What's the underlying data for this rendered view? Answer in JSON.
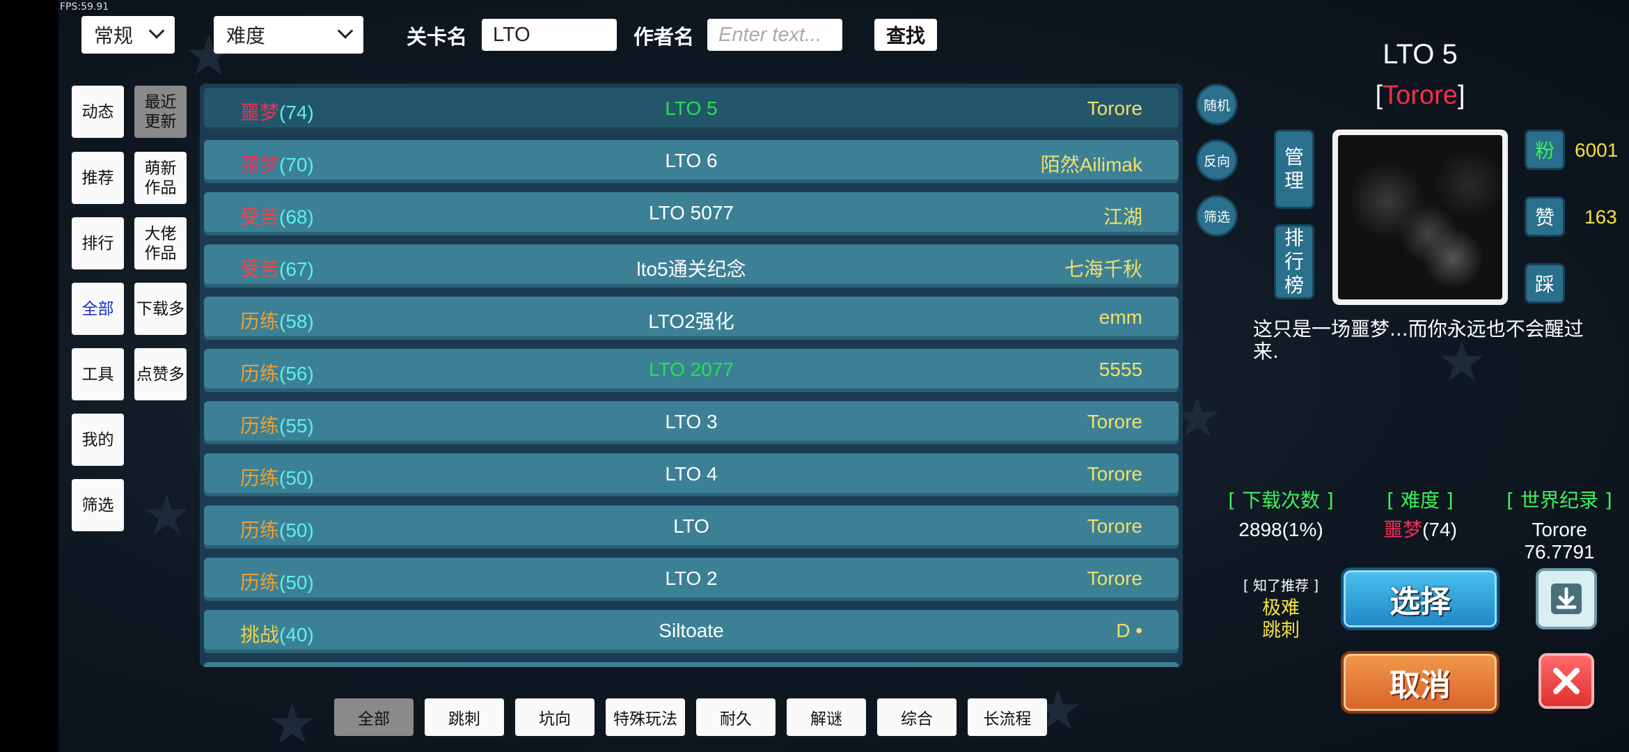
{
  "fps": "FPS:59.91",
  "top_bar": {
    "mode_dropdown": "常规",
    "difficulty_dropdown": "难度",
    "level_name_label": "关卡名",
    "level_name_value": "LTO",
    "author_label": "作者名",
    "author_placeholder": "Enter text...",
    "search_button": "查找"
  },
  "left_categories": {
    "col1": [
      "动态",
      "推荐",
      "排行",
      "全部",
      "工具",
      "我的",
      "筛选"
    ],
    "col2": [
      "最近\n更新",
      "萌新\n作品",
      "大佬\n作品",
      "下载多",
      "点赞多"
    ]
  },
  "levels": [
    {
      "diff": "噩梦",
      "num": "(74)",
      "name": "LTO 5",
      "author": "Torore"
    },
    {
      "diff": "噩梦",
      "num": "(70)",
      "name": "LTO 6",
      "author": "陌然Ailimak"
    },
    {
      "diff": "受苦",
      "num": "(68)",
      "name": "LTO 5077",
      "author": "江湖"
    },
    {
      "diff": "受苦",
      "num": "(67)",
      "name": "lto5通关纪念",
      "author": "七海千秋"
    },
    {
      "diff": "历练",
      "num": "(58)",
      "name": "LTO2强化",
      "author": "emm"
    },
    {
      "diff": "历练",
      "num": "(56)",
      "name": "LTO 2077",
      "author": "5555"
    },
    {
      "diff": "历练",
      "num": "(55)",
      "name": "LTO 3",
      "author": "Torore"
    },
    {
      "diff": "历练",
      "num": "(50)",
      "name": "LTO 4",
      "author": "Torore"
    },
    {
      "diff": "历练",
      "num": "(50)",
      "name": "LTO",
      "author": "Torore"
    },
    {
      "diff": "历练",
      "num": "(50)",
      "name": "LTO 2",
      "author": "Torore"
    },
    {
      "diff": "挑战",
      "num": "(40)",
      "name": "Siltoate",
      "author": "D •"
    }
  ],
  "side_round_buttons": [
    "随机",
    "反向",
    "筛选"
  ],
  "bottom_tags": [
    "全部",
    "跳刺",
    "坑向",
    "特殊玩法",
    "耐久",
    "解谜",
    "综合",
    "长流程"
  ],
  "detail": {
    "title": "LTO 5",
    "author_open": "[",
    "author": "Torore",
    "author_close": "]",
    "manage_button": "管\n理",
    "leaderboard_button": "排\n行\n榜",
    "fans_label": "粉",
    "fans_value": "6001",
    "like_label": "赞",
    "like_value": "163",
    "dislike_label": "踩",
    "description": "这只是一场噩梦...而你永远也不会醒过来.",
    "downloads_head": "[ 下载次数 ]",
    "downloads_value": "2898(1%)",
    "difficulty_head": "[ 难度 ]",
    "difficulty_name": "噩梦",
    "difficulty_num": "(74)",
    "record_head": "[ 世界纪录 ]",
    "record_holder": "Torore",
    "record_time": "76.7791",
    "recommend_label": "[ 知了推荐 ]",
    "recommend_tag1": "极难",
    "recommend_tag2": "跳刺",
    "select_button": "选择",
    "cancel_button": "取消"
  },
  "colors": {
    "nightmare": "#f03058",
    "suffer": "#ff4040",
    "train": "#f0a030",
    "challenge": "#f4d040",
    "author": "#f2e06a",
    "green_title": "#27e04a"
  }
}
